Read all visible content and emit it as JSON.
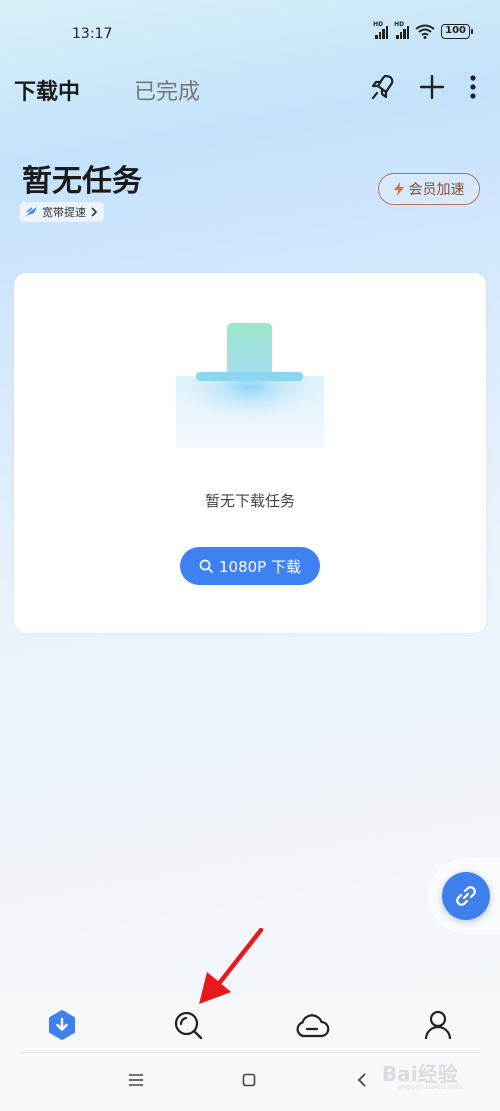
{
  "status_bar": {
    "time": "13:17",
    "battery": "100",
    "signal_labels": [
      "HD",
      "HD"
    ]
  },
  "header": {
    "tabs": [
      {
        "label": "下载中",
        "active": true
      },
      {
        "label": "已完成",
        "active": false
      }
    ],
    "icons": [
      "rocket-icon",
      "plus-icon",
      "more-icon"
    ]
  },
  "summary": {
    "title": "暂无任务",
    "speed_chip": "宽带提速",
    "vip_button": "会员加速"
  },
  "empty_state": {
    "message": "暂无下载任务",
    "action_button": "1080P 下载"
  },
  "bottom_nav": {
    "items": [
      "download-tab-icon",
      "search-tab-icon",
      "cloud-tab-icon",
      "profile-tab-icon"
    ],
    "active_index": 0
  },
  "watermark": {
    "text": "Bai经验",
    "sub": "jingyan.baidu.com"
  },
  "colors": {
    "accent": "#3d82f0",
    "vip": "#b7745a",
    "annotation_arrow": "#e8191b"
  }
}
